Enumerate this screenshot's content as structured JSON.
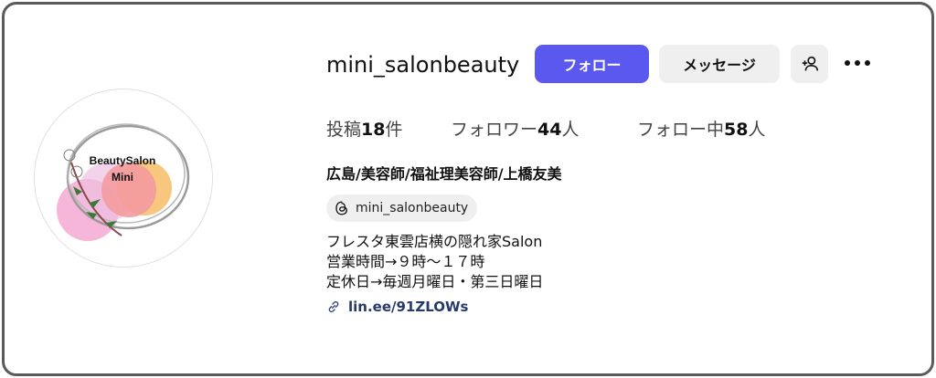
{
  "profile": {
    "username": "mini_salonbeauty",
    "avatar_text_line1": "BeautySalon",
    "avatar_text_line2": "Mini",
    "follow_label": "フォロー",
    "message_label": "メッセージ",
    "add_user_icon": "person-add-icon",
    "more_icon": "more-horizontal-icon"
  },
  "stats": {
    "posts_prefix": "投稿",
    "posts_count": "18",
    "posts_suffix": "件",
    "followers_prefix": "フォロワー",
    "followers_count": "44",
    "followers_suffix": "人",
    "following_prefix": "フォロー中",
    "following_count": "58",
    "following_suffix": "人"
  },
  "bio": {
    "full_name": "広島/美容師/福祉理美容師/上橋友美",
    "threads_handle": "mini_salonbeauty",
    "threads_icon": "threads-icon",
    "lines": [
      "フレスタ東雲店横の隠れ家Salon",
      "営業時間→９時〜１７時",
      "定休日→毎週月曜日・第三日曜日"
    ],
    "link_text": "lin.ee/91ZLOWs",
    "link_icon": "link-icon"
  },
  "colors": {
    "follow_button": "#5b58f0",
    "secondary_button": "#efefef",
    "link": "#243b6a",
    "frame_border": "#5a5a5a"
  }
}
